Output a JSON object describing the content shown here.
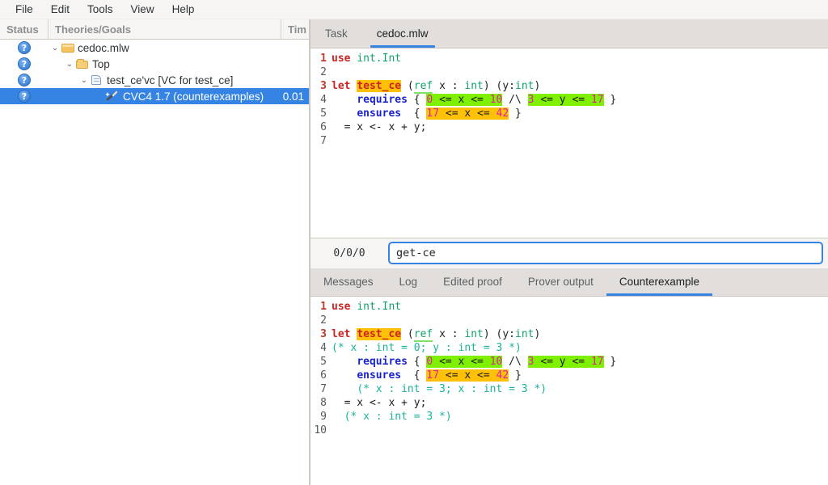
{
  "app": {
    "menu": [
      "File",
      "Edit",
      "Tools",
      "View",
      "Help"
    ]
  },
  "tree_panel": {
    "columns": {
      "status": "Status",
      "goals": "Theories/Goals",
      "time": "Tim"
    },
    "rows": [
      {
        "status_icon": "question-badge",
        "twisty": "⌄",
        "icon": "folder-closed-icon",
        "label": "cedoc.mlw",
        "time": "",
        "depth": 0,
        "selected": false
      },
      {
        "status_icon": "question-badge",
        "twisty": "⌄",
        "icon": "folder-open-icon",
        "label": "Top",
        "time": "",
        "depth": 1,
        "selected": false
      },
      {
        "status_icon": "question-badge",
        "twisty": "⌄",
        "icon": "document-icon",
        "label": "test_ce'vc [VC for test_ce]",
        "time": "",
        "depth": 2,
        "selected": false
      },
      {
        "status_icon": "question-badge",
        "twisty": "",
        "icon": "wand-icon",
        "label": "CVC4 1.7 (counterexamples)",
        "time": "0.01",
        "depth": 3,
        "selected": true
      }
    ]
  },
  "top_editor": {
    "tabs": [
      {
        "label": "Task",
        "active": false
      },
      {
        "label": "cedoc.mlw",
        "active": true
      }
    ],
    "lines": [
      {
        "n": "1",
        "hot": true,
        "tokens": [
          {
            "t": "use",
            "c": "kw"
          },
          {
            "t": " ",
            "c": "punct"
          },
          {
            "t": "int.Int",
            "c": "mod"
          }
        ]
      },
      {
        "n": "2",
        "hot": false,
        "tokens": []
      },
      {
        "n": "3",
        "hot": true,
        "tokens": [
          {
            "t": "let",
            "c": "kw"
          },
          {
            "t": " ",
            "c": "punct"
          },
          {
            "t": "test_ce",
            "c": "hl-name"
          },
          {
            "t": " (",
            "c": "punct"
          },
          {
            "t": "ref",
            "c": "ref-u"
          },
          {
            "t": " x : ",
            "c": "punct"
          },
          {
            "t": "int",
            "c": "typ"
          },
          {
            "t": ") (y:",
            "c": "punct"
          },
          {
            "t": "int",
            "c": "typ"
          },
          {
            "t": ")",
            "c": "punct"
          }
        ]
      },
      {
        "n": "4",
        "hot": false,
        "tokens": [
          {
            "t": "    ",
            "c": "punct"
          },
          {
            "t": "requires",
            "c": "kw2"
          },
          {
            "t": " { ",
            "c": "punct"
          },
          {
            "t": "0",
            "c": "num hl-grn"
          },
          {
            "t": " <= x <= ",
            "c": "punct hl-grn"
          },
          {
            "t": "10",
            "c": "num hl-grn"
          },
          {
            "t": " /\\ ",
            "c": "punct"
          },
          {
            "t": "3",
            "c": "num hl-grn"
          },
          {
            "t": " <= y <= ",
            "c": "punct hl-grn"
          },
          {
            "t": "17",
            "c": "num hl-grn"
          },
          {
            "t": " }",
            "c": "punct"
          }
        ]
      },
      {
        "n": "5",
        "hot": false,
        "tokens": [
          {
            "t": "    ",
            "c": "punct"
          },
          {
            "t": "ensures",
            "c": "kw2"
          },
          {
            "t": "  { ",
            "c": "punct"
          },
          {
            "t": "17",
            "c": "num hl-amb"
          },
          {
            "t": " <= x <= ",
            "c": "punct hl-amb"
          },
          {
            "t": "42",
            "c": "num hl-amb"
          },
          {
            "t": " }",
            "c": "punct"
          }
        ]
      },
      {
        "n": "6",
        "hot": false,
        "tokens": [
          {
            "t": "  = x <- x + y;",
            "c": "punct"
          }
        ]
      },
      {
        "n": "7",
        "hot": false,
        "tokens": []
      }
    ]
  },
  "midbar": {
    "counter": "0/0/0",
    "command_value": "get-ce",
    "command_placeholder": ""
  },
  "bottom_panel": {
    "tabs": [
      {
        "label": "Messages",
        "active": false
      },
      {
        "label": "Log",
        "active": false
      },
      {
        "label": "Edited proof",
        "active": false
      },
      {
        "label": "Prover output",
        "active": false
      },
      {
        "label": "Counterexample",
        "active": true
      }
    ],
    "lines": [
      {
        "n": "1",
        "hot": true,
        "tokens": [
          {
            "t": "use",
            "c": "kw"
          },
          {
            "t": " ",
            "c": "punct"
          },
          {
            "t": "int.Int",
            "c": "mod"
          }
        ]
      },
      {
        "n": "2",
        "hot": false,
        "tokens": []
      },
      {
        "n": "3",
        "hot": true,
        "tokens": [
          {
            "t": "let",
            "c": "kw"
          },
          {
            "t": " ",
            "c": "punct"
          },
          {
            "t": "test_ce",
            "c": "hl-name"
          },
          {
            "t": " (",
            "c": "punct"
          },
          {
            "t": "ref",
            "c": "ref-u"
          },
          {
            "t": " x : ",
            "c": "punct"
          },
          {
            "t": "int",
            "c": "typ"
          },
          {
            "t": ") (y:",
            "c": "punct"
          },
          {
            "t": "int",
            "c": "typ"
          },
          {
            "t": ")",
            "c": "punct"
          }
        ]
      },
      {
        "n": "4",
        "hot": false,
        "tokens": [
          {
            "t": "(* x : int = 0; y : int = 3 *)",
            "c": "cmt"
          }
        ]
      },
      {
        "n": "5",
        "hot": false,
        "tokens": [
          {
            "t": "    ",
            "c": "punct"
          },
          {
            "t": "requires",
            "c": "kw2"
          },
          {
            "t": " { ",
            "c": "punct"
          },
          {
            "t": "0",
            "c": "num hl-grn"
          },
          {
            "t": " <= x <= ",
            "c": "punct hl-grn"
          },
          {
            "t": "10",
            "c": "num hl-grn"
          },
          {
            "t": " /\\ ",
            "c": "punct"
          },
          {
            "t": "3",
            "c": "num hl-grn"
          },
          {
            "t": " <= y <= ",
            "c": "punct hl-grn"
          },
          {
            "t": "17",
            "c": "num hl-grn"
          },
          {
            "t": " }",
            "c": "punct"
          }
        ]
      },
      {
        "n": "6",
        "hot": false,
        "tokens": [
          {
            "t": "    ",
            "c": "punct"
          },
          {
            "t": "ensures",
            "c": "kw2"
          },
          {
            "t": "  { ",
            "c": "punct"
          },
          {
            "t": "17",
            "c": "num hl-amb"
          },
          {
            "t": " <= x <= ",
            "c": "punct hl-amb"
          },
          {
            "t": "42",
            "c": "num hl-amb"
          },
          {
            "t": " }",
            "c": "punct"
          }
        ]
      },
      {
        "n": "7",
        "hot": false,
        "tokens": [
          {
            "t": "    ",
            "c": "punct"
          },
          {
            "t": "(* x : int = 3; x : int = 3 *)",
            "c": "cmt"
          }
        ]
      },
      {
        "n": "8",
        "hot": false,
        "tokens": [
          {
            "t": "  = x <- x + y;",
            "c": "punct"
          }
        ]
      },
      {
        "n": "9",
        "hot": false,
        "tokens": [
          {
            "t": "  ",
            "c": "punct"
          },
          {
            "t": "(* x : int = 3 *)",
            "c": "cmt"
          }
        ]
      },
      {
        "n": "10",
        "hot": false,
        "tokens": []
      }
    ]
  },
  "colors": {
    "accent": "#3584e4",
    "selection": "#3584e4",
    "highlight_green": "#7ff000",
    "highlight_amber": "#ffc107",
    "keyword_red": "#cc2222",
    "keyword_blue": "#1a24c9",
    "type_green": "#11a36a",
    "number_magenta": "#e0219c",
    "comment_teal": "#18b39a"
  }
}
